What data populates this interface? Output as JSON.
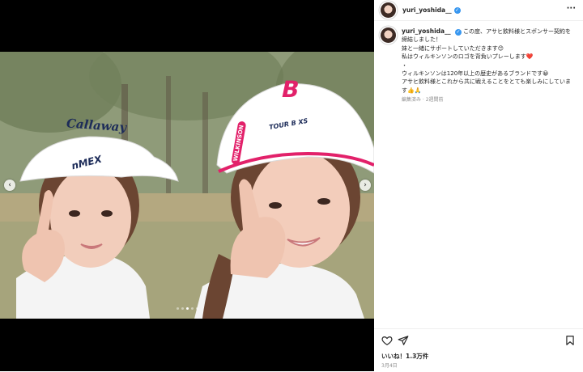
{
  "post": {
    "username": "yuri_yoshida__",
    "verified": true,
    "more_icon": "ellipsis-icon",
    "image": {
      "alt": "",
      "visor_brand": "Callaway",
      "visor_sub": "nMEX",
      "cap_brand": "WILKINSON",
      "cap_logo": "B",
      "cap_sub": "TOUR B XS",
      "slide_count": 5,
      "active_slide": 3
    },
    "caption": {
      "lines": [
        "この度、アサヒ飲料様とスポンサー契約を締結しました！",
        "妹と一緒にサポートしていただきます😊",
        "私はウィルキンソンのロゴを背負いプレーします❤️",
        "・",
        "ウィルキンソンは120年以上の歴史があるブランドです😀",
        "アサヒ飲料様とこれから共に戦えることをとても楽しみにしています👍🙏"
      ],
      "meta": "編集済み · 2週間前"
    },
    "likes": "いいね！1.3万件",
    "date": "3月4日"
  },
  "colors": {
    "verified": "#3897f0",
    "pink": "#e2216a",
    "text": "#262626",
    "muted": "#8e8e8e"
  },
  "icons": {
    "like": "heart-icon",
    "share": "paper-plane-icon",
    "save": "bookmark-icon",
    "prev": "chevron-left-icon",
    "next": "chevron-right-icon"
  }
}
